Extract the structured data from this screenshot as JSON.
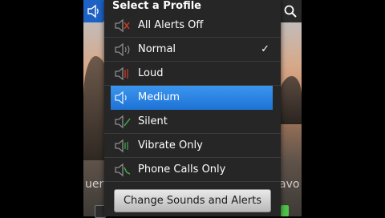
{
  "popup": {
    "title": "Select a Profile",
    "selected_index": 3,
    "items": [
      {
        "label": "All Alerts Off",
        "icon": "speaker-muted-icon",
        "accent": "#c23a2a",
        "checked": false
      },
      {
        "label": "Normal",
        "icon": "speaker-icon",
        "accent": "#9a9a9a",
        "checked": true
      },
      {
        "label": "Loud",
        "icon": "speaker-loud-icon",
        "accent": "#c23a2a",
        "checked": false
      },
      {
        "label": "Medium",
        "icon": "speaker-medium-icon",
        "accent": "#5aa8f2",
        "checked": false
      },
      {
        "label": "Silent",
        "icon": "speaker-silent-icon",
        "accent": "#3fa34a",
        "checked": false
      },
      {
        "label": "Vibrate Only",
        "icon": "vibrate-icon",
        "accent": "#3fa34a",
        "checked": false
      },
      {
        "label": "Phone Calls Only",
        "icon": "phone-calls-icon",
        "accent": "#3fa34a",
        "checked": false
      }
    ],
    "check_mark": "✓",
    "footer_button": "Change Sounds and Alerts"
  },
  "background": {
    "left_text": "uer",
    "right_text": "avo"
  },
  "colors": {
    "selection": "#2a82e4",
    "popup_bg": "#262626",
    "toolbar_blue": "#1d62c4"
  }
}
